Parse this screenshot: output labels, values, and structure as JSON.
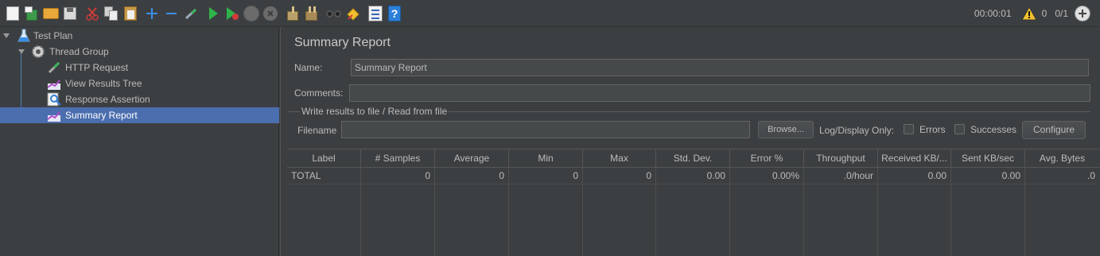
{
  "status": {
    "elapsed": "00:00:01",
    "warnings": "0",
    "threads": "0/1"
  },
  "toolbar": {
    "icons": [
      "new-icon",
      "templates-icon",
      "open-icon",
      "save-icon",
      "cut-icon",
      "copy-icon",
      "paste-icon",
      "expand-icon",
      "collapse-icon",
      "toggle-icon",
      "start-icon",
      "start-no-timers-icon",
      "stop-icon",
      "shutdown-icon",
      "clear-icon",
      "clear-all-icon",
      "search-icon",
      "reset-search-icon",
      "function-helper-icon",
      "help-icon"
    ]
  },
  "tree": {
    "items": [
      {
        "label": "Test Plan",
        "icon": "test-plan-icon"
      },
      {
        "label": "Thread Group",
        "icon": "thread-group-icon"
      },
      {
        "label": "HTTP Request",
        "icon": "http-request-icon"
      },
      {
        "label": "View Results Tree",
        "icon": "view-results-tree-icon"
      },
      {
        "label": "Response Assertion",
        "icon": "response-assertion-icon"
      },
      {
        "label": "Summary Report",
        "icon": "summary-report-icon"
      }
    ]
  },
  "panel": {
    "title": "Summary Report",
    "name_label": "Name:",
    "name_value": "Summary Report",
    "comments_label": "Comments:",
    "comments_value": "",
    "file_section_title": "Write results to file / Read from file",
    "filename_label": "Filename",
    "filename_value": "",
    "browse_label": "Browse...",
    "log_display_label": "Log/Display Only:",
    "errors_label": "Errors",
    "successes_label": "Successes",
    "configure_label": "Configure"
  },
  "table": {
    "headers": [
      "Label",
      "# Samples",
      "Average",
      "Min",
      "Max",
      "Std. Dev.",
      "Error %",
      "Throughput",
      "Received KB/...",
      "Sent KB/sec",
      "Avg. Bytes"
    ],
    "rows": [
      [
        "TOTAL",
        "0",
        "0",
        "0",
        "0",
        "0.00",
        "0.00%",
        ".0/hour",
        "0.00",
        "0.00",
        ".0"
      ]
    ]
  },
  "colors": {
    "selection": "#4b6eaf",
    "background": "#3c3f41",
    "accent_line": "#4b7fb8"
  }
}
